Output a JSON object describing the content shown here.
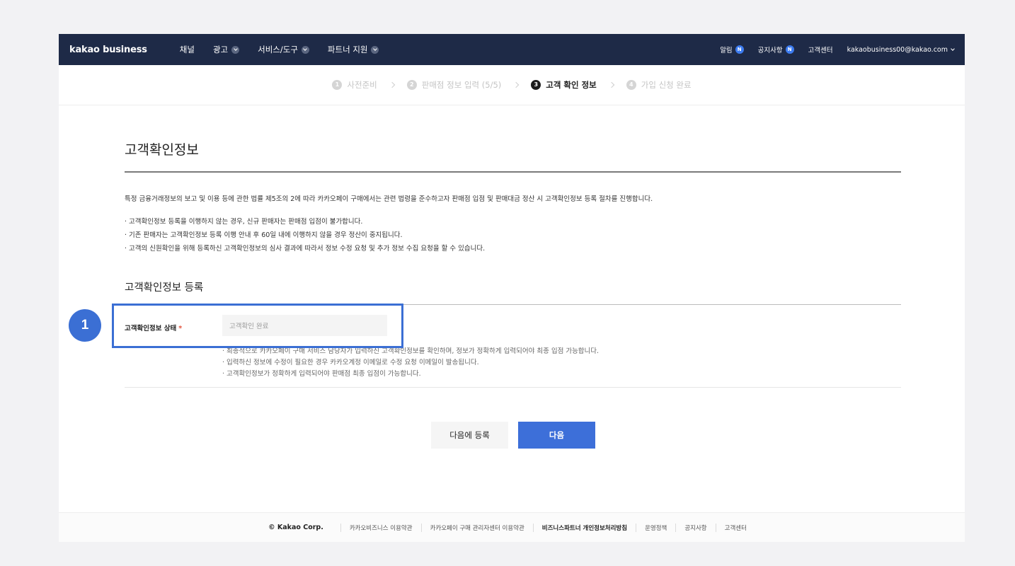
{
  "header": {
    "logo": "kakao business",
    "nav": [
      {
        "label": "채널",
        "has_dropdown": false
      },
      {
        "label": "광고",
        "has_dropdown": true
      },
      {
        "label": "서비스/도구",
        "has_dropdown": true
      },
      {
        "label": "파트너 지원",
        "has_dropdown": true
      }
    ],
    "alerts_label": "알림",
    "notice_label": "공지사항",
    "badge_text": "N",
    "support_label": "고객센터",
    "account": "kakaobusiness00@kakao.com"
  },
  "steps": [
    {
      "num": "1",
      "label": "사전준비",
      "state": "done"
    },
    {
      "num": "2",
      "label": "판매점 정보 입력 (5/5)",
      "state": "done"
    },
    {
      "num": "3",
      "label": "고객 확인 정보",
      "state": "active"
    },
    {
      "num": "4",
      "label": "가입 신청 완료",
      "state": "pending"
    }
  ],
  "main": {
    "title": "고객확인정보",
    "intro": "특정 금융거래정보의 보고 및 이용 등에 관한 법률 제5조의 2에 따라 카카오페이 구매에서는 관련 법령을 준수하고자 판매점 입점 및 판매대금 정산 시 고객확인정보 등록 절차를 진행합니다.",
    "bullets": [
      "고객확인정보 등록을 이행하지 않는 경우, 신규 판매자는 판매점 입점이 불가합니다.",
      "기존 판매자는 고객확인정보 등록 이행 안내 후 60일 내에 이행하지 않을 경우 정산이 중지됩니다.",
      "고객의 신원확인을 위해 등록하신 고객확인정보의 심사 결과에 따라서 정보 수정 요청 및 추가 정보 수집 요청을 할 수 있습니다."
    ],
    "section_title": "고객확인정보 등록",
    "field": {
      "label": "고객확인정보 상태",
      "required_mark": "*",
      "value": "고객확인 완료"
    },
    "help": [
      "최종적으로 카카오페이 구매 서비스 담당자가 입력하신 고객확인정보를 확인하며, 정보가 정확하게 입력되어야 최종 입점 가능합니다.",
      "입력하신 정보에 수정이 필요한 경우 카카오계정 이메일로 수정 요청 이메일이 발송됩니다.",
      "고객확인정보가 정확하게 입력되어야 판매점 최종 입점이 가능합니다."
    ],
    "secondary_button": "다음에 등록",
    "primary_button": "다음"
  },
  "footer": {
    "copyright": "© Kakao Corp.",
    "links": [
      {
        "label": "카카오비즈니스 이용약관",
        "bold": false
      },
      {
        "label": "카카오페이 구매 관리자센터 이용약관",
        "bold": false
      },
      {
        "label": "비즈니스파트너 개인정보처리방침",
        "bold": true
      },
      {
        "label": "운영정책",
        "bold": false
      },
      {
        "label": "공지사항",
        "bold": false
      },
      {
        "label": "고객센터",
        "bold": false
      }
    ]
  },
  "annotation": {
    "number": "1"
  },
  "colors": {
    "nav_bg": "#1e2a47",
    "primary": "#3d6fd9",
    "annotation": "#3b6fd4",
    "required": "#e2533d"
  }
}
